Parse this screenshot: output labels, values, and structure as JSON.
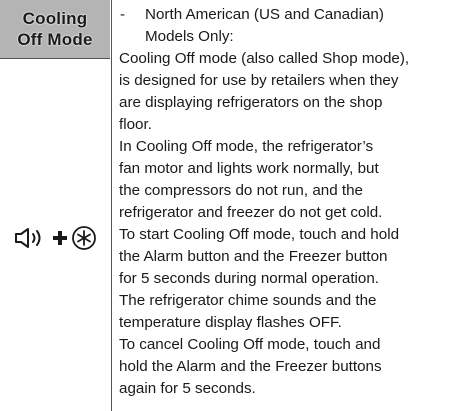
{
  "table": {
    "header": [
      "Cooling",
      "Off Mode"
    ],
    "icons": [
      "alarm-icon",
      "plus-icon",
      "freezer-icon"
    ],
    "bullet": {
      "dash": "-",
      "lines": [
        "North American (US and Canadian)",
        "Models Only:"
      ]
    },
    "paragraphs": [
      [
        "Cooling Off mode (also called Shop mode),",
        "is designed for use by retailers when they",
        "are displaying refrigerators on the shop",
        "floor."
      ],
      [
        "In Cooling Off mode, the refrigerator’s",
        "fan motor and lights work normally, but",
        "the compressors do not run, and the",
        "refrigerator and freezer do not get cold."
      ],
      [
        "To start Cooling Off mode, touch and hold",
        "the Alarm button and the Freezer button",
        "for 5 seconds during normal operation.",
        "The refrigerator chime sounds and the",
        "temperature display flashes OFF."
      ],
      [
        "To cancel Cooling Off mode, touch and",
        "hold the Alarm and the Freezer buttons",
        "again for 5 seconds."
      ]
    ]
  }
}
